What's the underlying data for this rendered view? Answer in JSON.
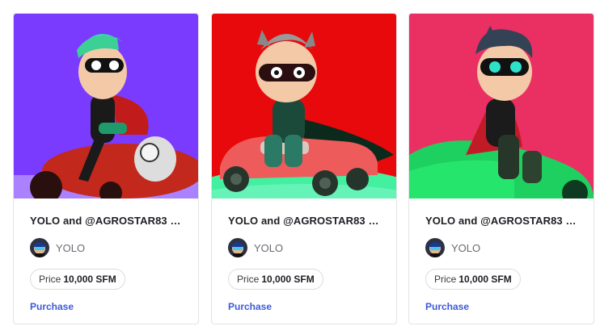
{
  "cards": [
    {
      "title": "YOLO and @AGROSTAR83 C...",
      "owner": "YOLO",
      "price_label": "Price",
      "price_value": "10,000 SFM",
      "action": "Purchase",
      "bg_color": "#7a3bff"
    },
    {
      "title": "YOLO and @AGROSTAR83 C...",
      "owner": "YOLO",
      "price_label": "Price",
      "price_value": "10,000 SFM",
      "action": "Purchase",
      "bg_color": "#e8090c"
    },
    {
      "title": "YOLO and @AGROSTAR83 C...",
      "owner": "YOLO",
      "price_label": "Price",
      "price_value": "10,000 SFM",
      "action": "Purchase",
      "bg_color": "#ea2f63"
    }
  ],
  "colors": {
    "link": "#3d5ad8",
    "border": "#e3e3e3"
  }
}
